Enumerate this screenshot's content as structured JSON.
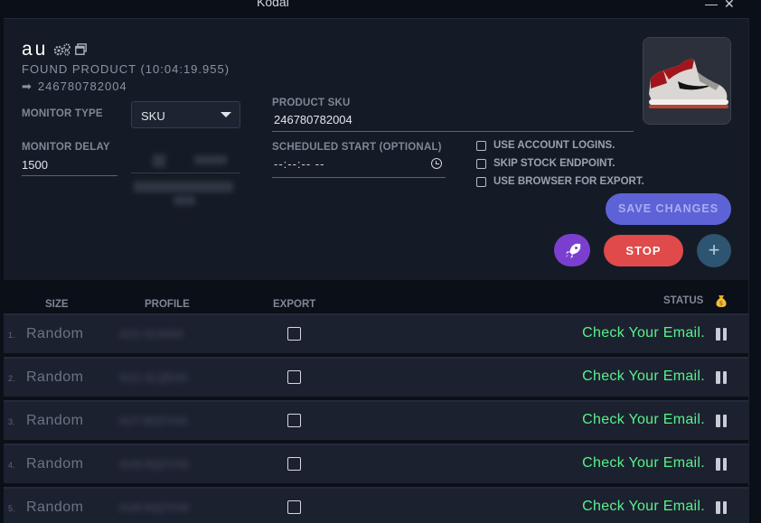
{
  "window": {
    "title": "Kodai",
    "minimize_glyph": "—",
    "close_glyph": "✕"
  },
  "task": {
    "name": "au",
    "found_text": "FOUND PRODUCT (10:04:19.955)",
    "found_sku": "246780782004",
    "arrow_glyph": "➡"
  },
  "form": {
    "monitor_type_label": "MONITOR TYPE",
    "monitor_type_value": "SKU",
    "monitor_delay_label": "MONITOR DELAY",
    "monitor_delay_value": "1500",
    "product_sku_label": "PRODUCT SKU",
    "product_sku_value": "246780782004",
    "scheduled_start_label": "SCHEDULED START (OPTIONAL)",
    "scheduled_start_value": "--:--:-- --"
  },
  "options": [
    {
      "label": "USE ACCOUNT LOGINS.",
      "checked": false
    },
    {
      "label": "SKIP STOCK ENDPOINT.",
      "checked": false
    },
    {
      "label": "USE BROWSER FOR EXPORT.",
      "checked": false
    }
  ],
  "buttons": {
    "save": "SAVE CHANGES",
    "stop": "STOP",
    "add": "+"
  },
  "table": {
    "headers": {
      "size": "SIZE",
      "profile": "PROFILE",
      "export": "EXPORT",
      "status": "STATUS"
    },
    "rows": [
      {
        "index": "1.",
        "size": "Random",
        "profile": "AU1-SLINHA",
        "status": "Check Your Email."
      },
      {
        "index": "2.",
        "size": "Random",
        "profile": "AU1-SLQEHA",
        "status": "Check Your Email."
      },
      {
        "index": "3.",
        "size": "Random",
        "profile": "AU7-BSZYHA",
        "status": "Check Your Email."
      },
      {
        "index": "4.",
        "size": "Random",
        "profile": "AU8-NQZYHA",
        "status": "Check Your Email."
      },
      {
        "index": "5.",
        "size": "Random",
        "profile": "AU8-NQZYHA",
        "status": "Check Your Email."
      }
    ]
  },
  "colors": {
    "status_green": "#58f28a",
    "save_button": "#5d63d6",
    "stop_button": "#e04a4a",
    "rocket_button": "#7b3fd0",
    "add_button": "#2d5470"
  }
}
